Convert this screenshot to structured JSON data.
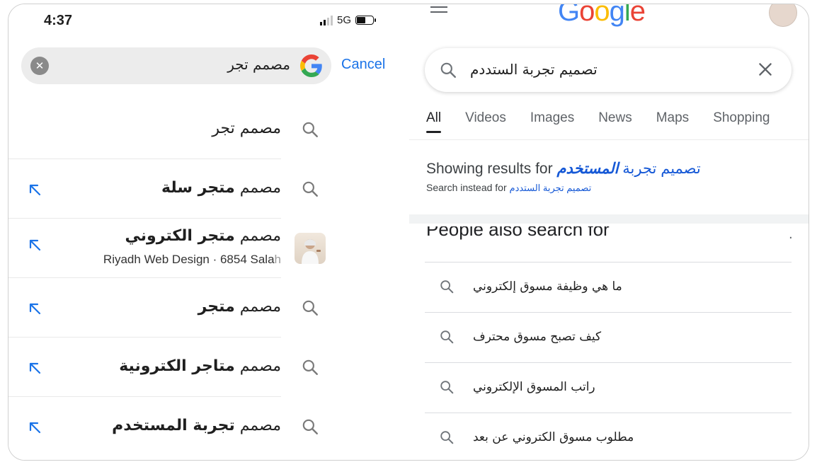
{
  "left_phone": {
    "status": {
      "time": "4:37",
      "network": "5G"
    },
    "search": {
      "query": "مصمم تجر",
      "cancel_label": "Cancel"
    },
    "suggestions": [
      {
        "plain": "مصمم تجر",
        "bold": "",
        "subtitle": "",
        "subtitle_faded": "",
        "icon": "search-icon",
        "arrow": false,
        "thumb": false
      },
      {
        "plain": "مصمم ",
        "bold": "متجر سلة",
        "subtitle": "",
        "subtitle_faded": "",
        "icon": "search-icon",
        "arrow": true,
        "thumb": false
      },
      {
        "plain": "مصمم ",
        "bold": "متجر الكتروني",
        "subtitle": "Riyadh Web Design · 6854 Sala",
        "subtitle_faded": "h",
        "icon": "thumbnail",
        "arrow": true,
        "thumb": true
      },
      {
        "plain": "مصمم ",
        "bold": "متجر",
        "subtitle": "",
        "subtitle_faded": "",
        "icon": "search-icon",
        "arrow": true,
        "thumb": false
      },
      {
        "plain": "مصمم ",
        "bold": "متاجر الكترونية",
        "subtitle": "",
        "subtitle_faded": "",
        "icon": "search-icon",
        "arrow": true,
        "thumb": false
      },
      {
        "plain": "مصمم ",
        "bold": "تجربة المستخدم",
        "subtitle": "",
        "subtitle_faded": "",
        "icon": "search-icon",
        "arrow": true,
        "thumb": false
      }
    ]
  },
  "right_google": {
    "logo_text": "Google",
    "search": {
      "query": "تصميم تجربة الستددم"
    },
    "tabs": [
      "All",
      "Videos",
      "Images",
      "News",
      "Maps",
      "Shopping"
    ],
    "active_tab": "All",
    "correction": {
      "showing_label": "Showing results for",
      "corrected_plain": "تصميم تجربة ",
      "corrected_bold": "المستخدم",
      "instead_label": "Search instead for",
      "original_query": "تصميم تجربة الستددم"
    },
    "people_also_search": {
      "title": "People also search for",
      "more_icon": "·",
      "items": [
        "ما هي وظيفة مسوق إلكتروني",
        "كيف تصبح مسوق محترف",
        "راتب المسوق الإلكتروني",
        "مطلوب مسوق الكتروني عن بعد"
      ]
    }
  },
  "colors": {
    "link_blue": "#1558d6",
    "cancel_blue": "#1a73e8",
    "arrow_blue": "#1a73e8",
    "google_blue": "#4285f4",
    "google_red": "#ea4335",
    "google_yellow": "#fbbc05",
    "google_green": "#34a853"
  }
}
